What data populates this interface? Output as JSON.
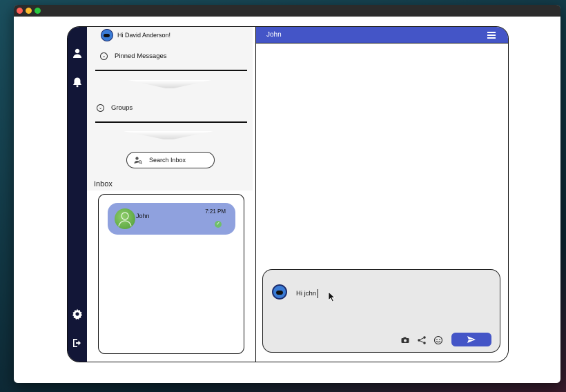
{
  "sidebar": {
    "greeting": "Hi David Anderson!",
    "pinned_label": "Pinned Messages",
    "groups_label": "Groups",
    "search_label": "Search Inbox",
    "inbox_title": "Inbox",
    "conversations": [
      {
        "name": "John",
        "time": "7:21 PM"
      }
    ]
  },
  "chat": {
    "contact_name": "John",
    "draft_text": "Hi jchn"
  },
  "icons": {
    "rail": [
      "user-icon",
      "bell-icon",
      "gear-icon",
      "logout-icon"
    ],
    "composer": [
      "camera-icon",
      "share-icon",
      "emoji-icon",
      "send-icon"
    ]
  },
  "colors": {
    "rail_bg": "#121637",
    "accent": "#4455c7",
    "chat_item_bg": "#8fa1de"
  }
}
